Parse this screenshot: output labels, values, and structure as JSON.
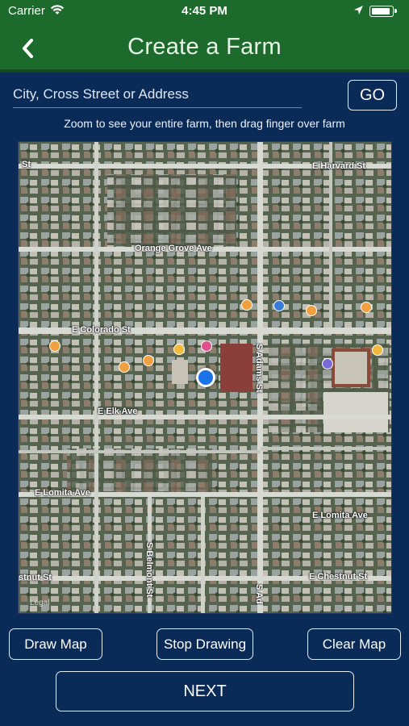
{
  "status_bar": {
    "carrier": "Carrier",
    "time": "4:45 PM",
    "icons": [
      "wifi-icon",
      "location-arrow-icon",
      "battery-icon"
    ]
  },
  "nav": {
    "title": "Create a Farm",
    "back_icon": "chevron-left-icon"
  },
  "search": {
    "placeholder": "City, Cross Street or Address",
    "value": "",
    "go_label": "GO"
  },
  "hint": "Zoom to see your entire farm, then drag finger over farm",
  "map": {
    "labels": {
      "st_left": "St",
      "e_harvard": "E Harvard St",
      "orange_grove": "Orange Grove Ave",
      "e_colorado": "E Colorado St",
      "s_adams": "S Adams St",
      "e_elk": "E Elk Ave",
      "e_lomita_left": "E Lomita Ave",
      "e_lomita_right": "E Lomita Ave",
      "s_belmont": "S Belmont St",
      "chestnut_left": "stnut St",
      "e_chestnut": "E Chestnut St",
      "s_adams_bottom": "S Ad"
    },
    "legal": "Legal",
    "poi_colors": {
      "orange": "#f0a040",
      "pink": "#e0508a",
      "yellow": "#f2b93b",
      "purple": "#7a6ad8",
      "blue": "#3b7bd8"
    }
  },
  "buttons": {
    "draw_map": "Draw Map",
    "stop_drawing": "Stop Drawing",
    "clear_map": "Clear Map",
    "next": "NEXT"
  },
  "colors": {
    "header_green": "#1d6b2c",
    "background_navy": "#0a2a57",
    "user_location_blue": "#1a73e8"
  }
}
